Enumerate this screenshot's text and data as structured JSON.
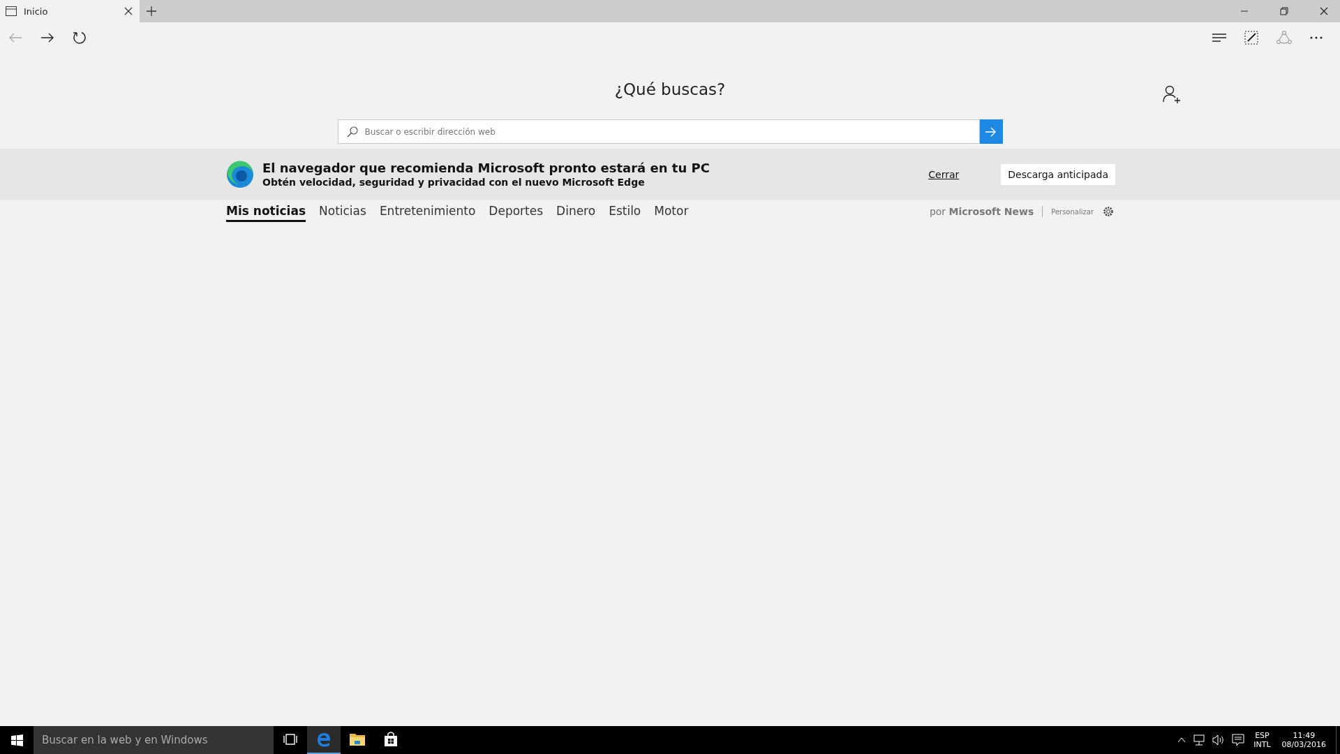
{
  "browser_tabs": [
    {
      "label": "Inicio",
      "selected": true
    }
  ],
  "nav": {
    "back_disabled": true
  },
  "heading": "¿Qué buscas?",
  "search": {
    "placeholder": "Buscar o escribir dirección web"
  },
  "banner": {
    "title": "El navegador que recomienda Microsoft pronto estará en tu PC",
    "subtitle": "Obtén velocidad, seguridad y privacidad con el nuevo Microsoft Edge",
    "close_link": "Cerrar",
    "action": "Descarga anticipada"
  },
  "news_tabs": [
    {
      "label": "Mis noticias",
      "selected": true
    },
    {
      "label": "Noticias",
      "selected": false
    },
    {
      "label": "Entretenimiento",
      "selected": false
    },
    {
      "label": "Deportes",
      "selected": false
    },
    {
      "label": "Dinero",
      "selected": false
    },
    {
      "label": "Estilo",
      "selected": false
    },
    {
      "label": "Motor",
      "selected": false
    }
  ],
  "news_source": {
    "credit": "por **Microsoft News**",
    "customize": "Personalizar"
  },
  "taskbar": {
    "search_placeholder": "Buscar en la web y en Windows",
    "apps": [
      {
        "kind": "edge",
        "active": true
      },
      {
        "kind": "explorer",
        "active": false
      },
      {
        "kind": "store",
        "active": false
      }
    ],
    "tray": {
      "language": "ESP",
      "layout": "INTL",
      "time": "11:49",
      "date": "08/03/2016"
    }
  }
}
